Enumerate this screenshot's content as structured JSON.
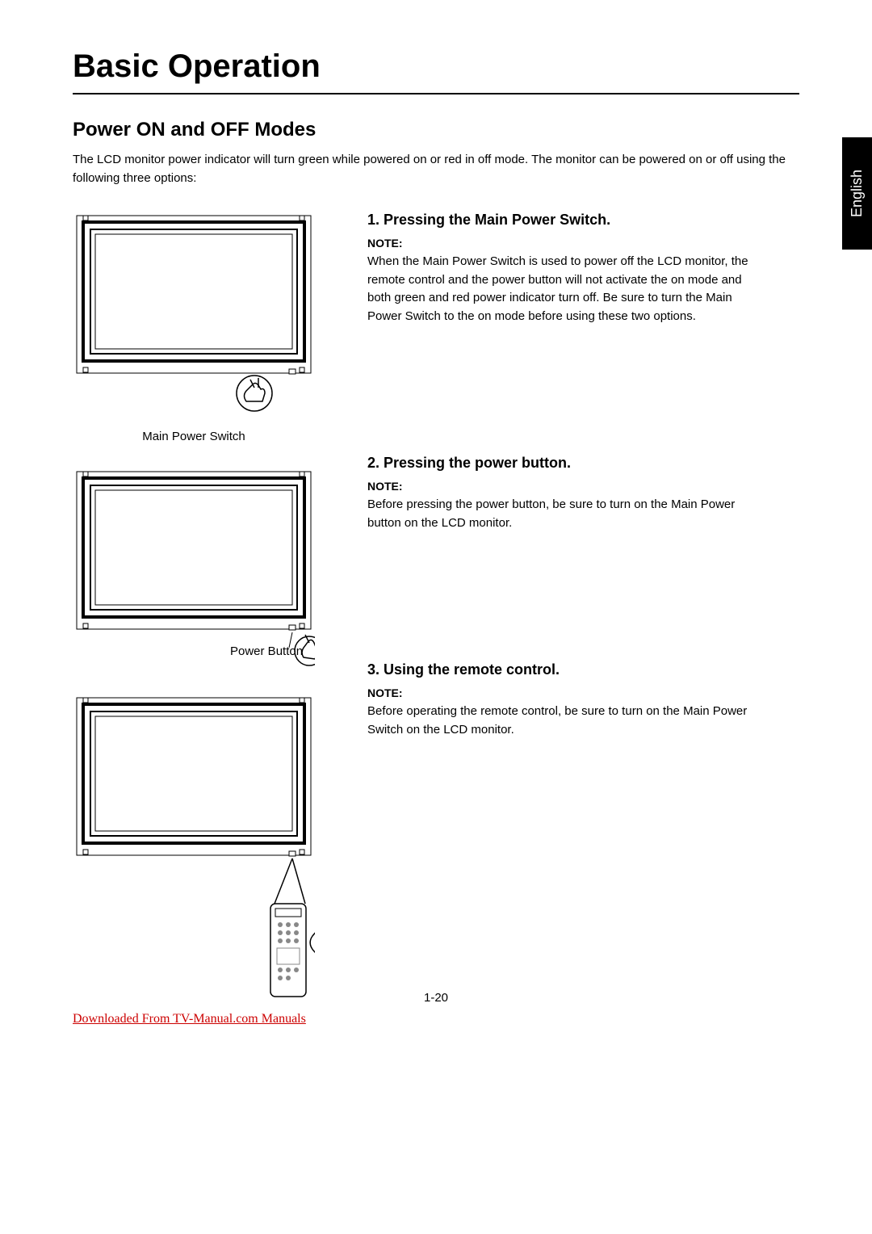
{
  "title": "Basic Operation",
  "language_tab": "English",
  "section_heading": "Power ON and OFF Modes",
  "intro": "The LCD monitor power indicator will turn green while powered on or red in off mode. The monitor can be powered on or off using the following three options:",
  "figures": {
    "fig1_caption": "Main Power Switch",
    "fig2_caption": "Power Button"
  },
  "steps": [
    {
      "heading": "1. Pressing the Main Power Switch.",
      "note_label": "NOTE:",
      "note": "When the Main Power Switch is used to power off the LCD monitor, the remote control and the power button will not  activate the on mode and both green and red power indicator turn off.  Be sure to turn the Main Power Switch to the on mode before using these two options."
    },
    {
      "heading": "2. Pressing the power button.",
      "note_label": "NOTE:",
      "note": "Before pressing the power button, be sure to turn on the Main Power button on the LCD monitor."
    },
    {
      "heading": "3. Using the remote control.",
      "note_label": "NOTE:",
      "note": "Before operating the remote control, be sure to turn on the Main Power Switch on the LCD monitor."
    }
  ],
  "page_number": "1-20",
  "download_text": "Downloaded From TV-Manual.com Manuals"
}
